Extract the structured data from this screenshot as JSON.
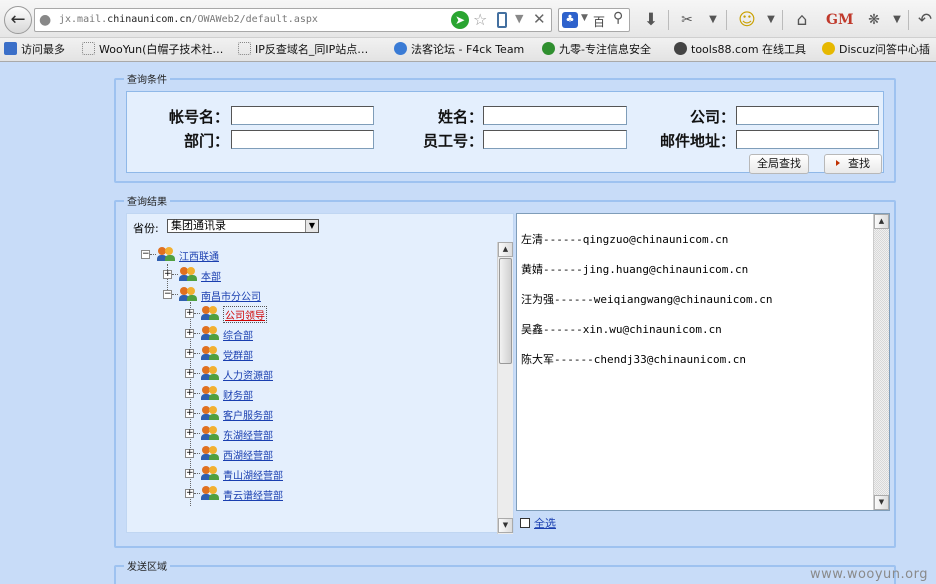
{
  "browser": {
    "url_prefix": "jx.mail.",
    "url_domain": "chinaunicom.cn",
    "url_path": "/OWAWeb2/default.aspx",
    "search_text": "百",
    "icons": [
      "back-icon",
      "globe-icon",
      "go-icon",
      "star-icon",
      "phone-icon",
      "dropdown-icon",
      "close-icon",
      "paw-icon",
      "magnifier-icon",
      "download-icon",
      "screenshot-icon",
      "smiley-icon",
      "home-icon",
      "gm-icon",
      "bug-icon",
      "undo-icon"
    ]
  },
  "bookmarks": [
    {
      "label": "访问最多",
      "color": "#3b6fc8"
    },
    {
      "label": "WooYun(白帽子技术社…",
      "color": "#ffffff"
    },
    {
      "label": "IP反查域名_同IP站点…",
      "color": "#ffffff"
    },
    {
      "label": "法客论坛 - F4ck Team",
      "color": "#3a7bd5"
    },
    {
      "label": "九零-专注信息安全",
      "color": "#2f8f2f"
    },
    {
      "label": "tools88.com 在线工具",
      "color": "#444444"
    },
    {
      "label": "Discuz问答中心插",
      "color": "#e6b800"
    }
  ],
  "query": {
    "legend": "查询条件",
    "account_label": "帐号名：",
    "name_label": "姓名：",
    "company_label": "公司：",
    "department_label": "部门：",
    "employee_id_label": "员工号：",
    "email_label": "邮件地址：",
    "account_value": "",
    "name_value": "",
    "company_value": "",
    "department_value": "",
    "employee_id_value": "",
    "email_value": "",
    "global_search_label": "全局查找",
    "search_label": "查找"
  },
  "results": {
    "legend": "查询结果",
    "province_label": "省份:",
    "province_selected": "集团通讯录",
    "tree": [
      {
        "label": "江西联通",
        "level": 0,
        "toggle": "−",
        "highlight": false
      },
      {
        "label": "本部",
        "level": 1,
        "toggle": "+",
        "highlight": false
      },
      {
        "label": "南昌市分公司",
        "level": 1,
        "toggle": "−",
        "highlight": false
      },
      {
        "label": "公司领导",
        "level": 2,
        "toggle": "+",
        "highlight": true
      },
      {
        "label": "综合部",
        "level": 2,
        "toggle": "+",
        "highlight": false
      },
      {
        "label": "党群部",
        "level": 2,
        "toggle": "+",
        "highlight": false
      },
      {
        "label": "人力资源部",
        "level": 2,
        "toggle": "+",
        "highlight": false
      },
      {
        "label": "财务部",
        "level": 2,
        "toggle": "+",
        "highlight": false
      },
      {
        "label": "客户服务部",
        "level": 2,
        "toggle": "+",
        "highlight": false
      },
      {
        "label": "东湖经营部",
        "level": 2,
        "toggle": "+",
        "highlight": false
      },
      {
        "label": "西湖经营部",
        "level": 2,
        "toggle": "+",
        "highlight": false
      },
      {
        "label": "青山湖经营部",
        "level": 2,
        "toggle": "+",
        "highlight": false
      },
      {
        "label": "青云谱经营部",
        "level": 2,
        "toggle": "+",
        "highlight": false
      }
    ],
    "contacts": [
      "左清------qingzuo@chinaunicom.cn",
      "黄婧------jing.huang@chinaunicom.cn",
      "汪为强------weiqiangwang@chinaunicom.cn",
      "吴鑫------xin.wu@chinaunicom.cn",
      "陈大军------chendj33@chinaunicom.cn"
    ],
    "select_all_label": "全选"
  },
  "send": {
    "legend": "发送区域"
  },
  "watermark": "www.wooyun.org"
}
